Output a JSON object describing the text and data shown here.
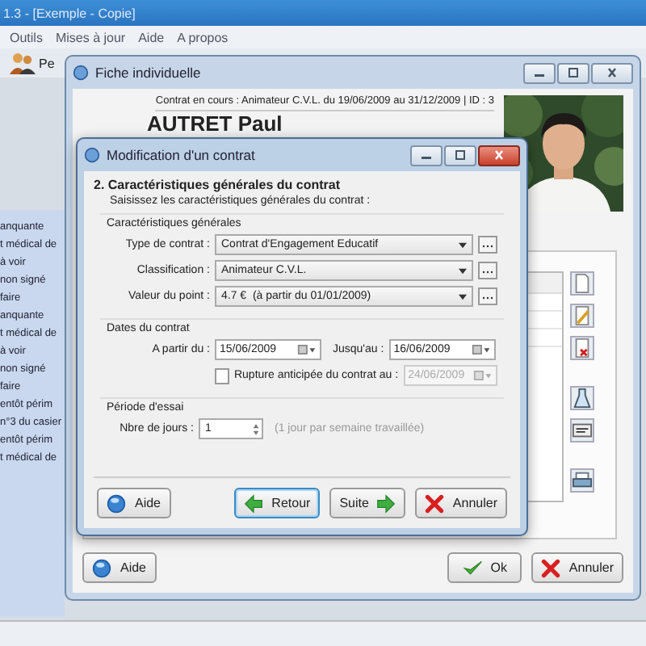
{
  "app": {
    "title": "1.3 - [Exemple - Copie]",
    "menu": [
      "Outils",
      "Mises à jour",
      "Aide",
      "A propos"
    ],
    "toolbar_label": "Pe"
  },
  "sidebar": {
    "items": [
      "anquante",
      "t médical de",
      "à voir",
      "non signé",
      "faire",
      "anquante",
      "t médical de",
      "à voir",
      "non signé",
      "faire",
      "entôt périm",
      "n°3 du casier",
      "entôt périm",
      "t médical de"
    ]
  },
  "fiche": {
    "title": "Fiche individuelle",
    "contract_line": "Contrat en cours : Animateur C.V.L. du 19/06/2009 au 31/12/2009 | ID : 3",
    "name": "AUTRET Paul",
    "buttons": [
      {
        "label": "Aide",
        "kind": "help"
      },
      {
        "label": "Ok",
        "kind": "ok"
      },
      {
        "label": "Annuler",
        "kind": "cancel"
      }
    ]
  },
  "dialog": {
    "title": "Modification d'un contrat",
    "heading": "2. Caractéristiques générales du contrat",
    "intro": "Saisissez les caractéristiques générales du contrat :",
    "general": {
      "title": "Caractéristiques générales",
      "combos": [
        {
          "label": "Type de contrat :",
          "value": "Contrat d'Engagement Educatif"
        },
        {
          "label": "Classification :",
          "value": "Animateur C.V.L."
        },
        {
          "label": "Valeur du point :",
          "value": "4.7 €  (à partir du 01/01/2009)"
        }
      ]
    },
    "dates": {
      "title": "Dates du contrat",
      "from": {
        "label": "A partir du :",
        "value": "15/06/2009",
        "disabled": false
      },
      "to": {
        "label": "Jusqu'au :",
        "value": "16/06/2009",
        "disabled": false
      },
      "rupture": {
        "label": "Rupture anticipée du contrat au :",
        "checked": false,
        "value": "24/06/2009",
        "disabled": true
      }
    },
    "trial": {
      "title": "Période d'essai",
      "label": "Nbre de jours :",
      "value": "1",
      "hint": "(1 jour par semaine travaillée)"
    },
    "buttons": [
      {
        "label": "Aide",
        "kind": "help",
        "default": false
      },
      {
        "label": "Retour",
        "kind": "back",
        "default": true
      },
      {
        "label": "Suite",
        "kind": "next",
        "default": false
      },
      {
        "label": "Annuler",
        "kind": "cancel",
        "default": false
      }
    ]
  }
}
